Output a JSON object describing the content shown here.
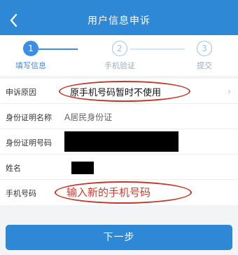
{
  "header": {
    "title": "用户信息申诉",
    "back_icon": "chevron-left-icon"
  },
  "steps": [
    {
      "num": "1",
      "label": "填写信息",
      "state": "active"
    },
    {
      "num": "2",
      "label": "手机验证",
      "state": "todo"
    },
    {
      "num": "3",
      "label": "提交",
      "state": "todo"
    }
  ],
  "form": {
    "reason": {
      "label": "申诉原因",
      "value": "原手机号码暂时不使用"
    },
    "id_type": {
      "label": "身份证明名称",
      "value": "A居民身份证"
    },
    "id_number": {
      "label": "身份证明号码"
    },
    "name": {
      "label": "姓名"
    },
    "phone": {
      "label": "手机号码",
      "placeholder": "输入新的手机号码"
    }
  },
  "next_button": "下一步",
  "colors": {
    "primary": "#2f88d6",
    "annotation_red": "#c0392b"
  }
}
